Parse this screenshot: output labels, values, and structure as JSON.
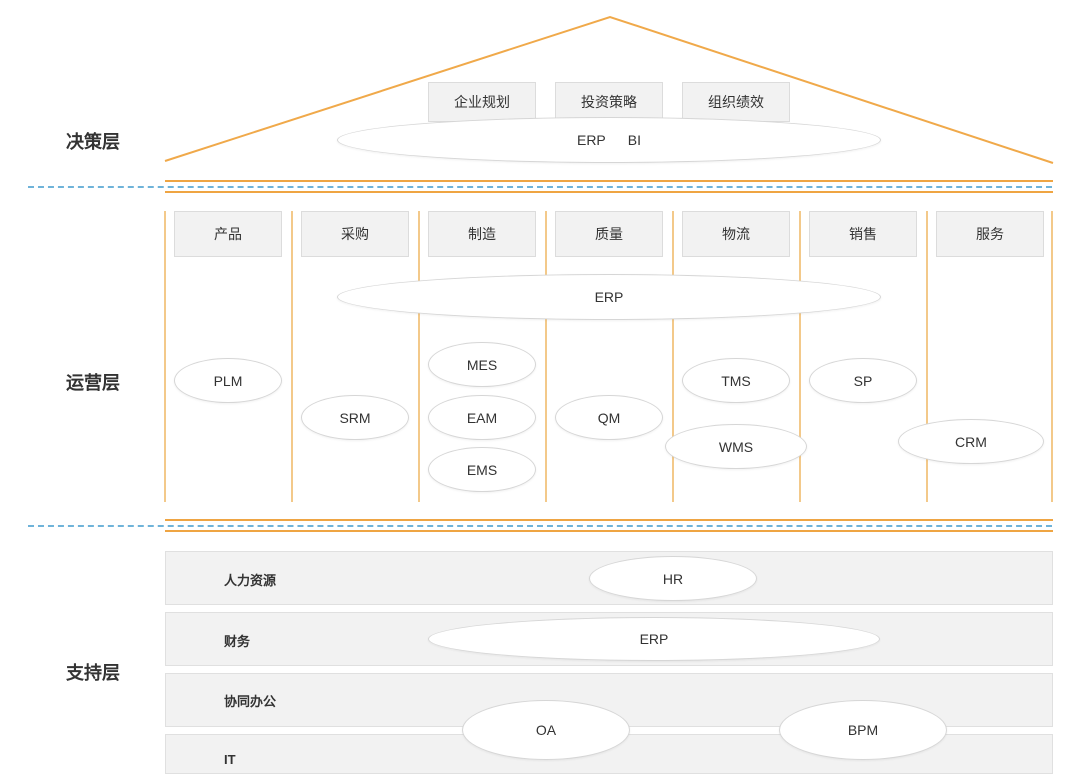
{
  "colors": {
    "roof": "#f0a94a",
    "column": "#f3c98a",
    "divider_dash": "#6fb3d9",
    "box_fill": "#f2f2f2"
  },
  "decision": {
    "label": "决策层",
    "boxes": [
      "企业规划",
      "投资策略",
      "组织绩效"
    ],
    "ellipse_erp": "ERP",
    "ellipse_bi": "BI"
  },
  "operation": {
    "label": "运营层",
    "columns": [
      "产品",
      "采购",
      "制造",
      "质量",
      "物流",
      "销售",
      "服务"
    ],
    "erp": "ERP",
    "systems": {
      "plm": "PLM",
      "srm": "SRM",
      "mes": "MES",
      "eam": "EAM",
      "ems": "EMS",
      "qm": "QM",
      "tms": "TMS",
      "wms": "WMS",
      "sp": "SP",
      "crm": "CRM"
    }
  },
  "support": {
    "label": "支持层",
    "bands": [
      "人力资源",
      "财务",
      "协同办公",
      "IT"
    ],
    "hr": "HR",
    "erp": "ERP",
    "oa": "OA",
    "bpm": "BPM"
  }
}
